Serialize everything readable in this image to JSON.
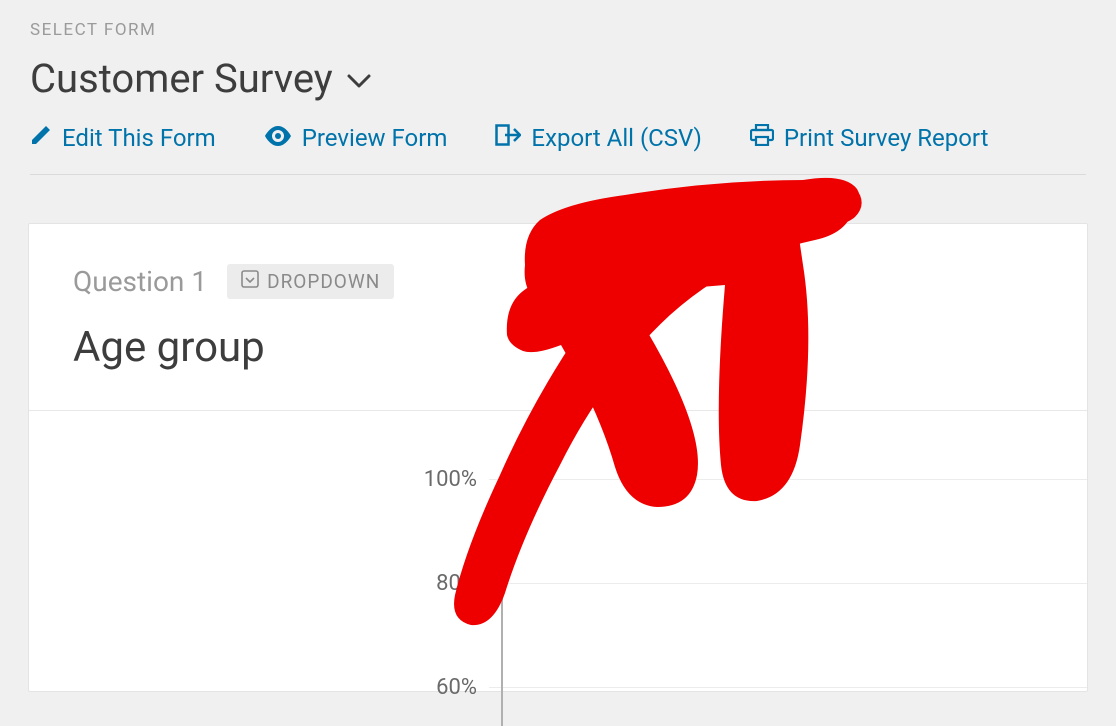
{
  "header": {
    "select_label": "SELECT FORM",
    "form_title": "Customer Survey"
  },
  "actions": {
    "edit": "Edit This Form",
    "preview": "Preview Form",
    "export": "Export All (CSV)",
    "print": "Print Survey Report"
  },
  "card": {
    "question_label": "Question 1",
    "badge_label": "DROPDOWN",
    "question_title": "Age group"
  },
  "chart_data": {
    "type": "bar",
    "title": "Age group",
    "ylabel": "",
    "ylim": [
      0,
      100
    ],
    "y_ticks": [
      "100%",
      "80%",
      "60%"
    ]
  },
  "colors": {
    "link": "#0073aa",
    "muted": "#9a9a9a",
    "text": "#3d3d3d",
    "badge_bg": "#ececec",
    "annotation": "#ee0000"
  }
}
